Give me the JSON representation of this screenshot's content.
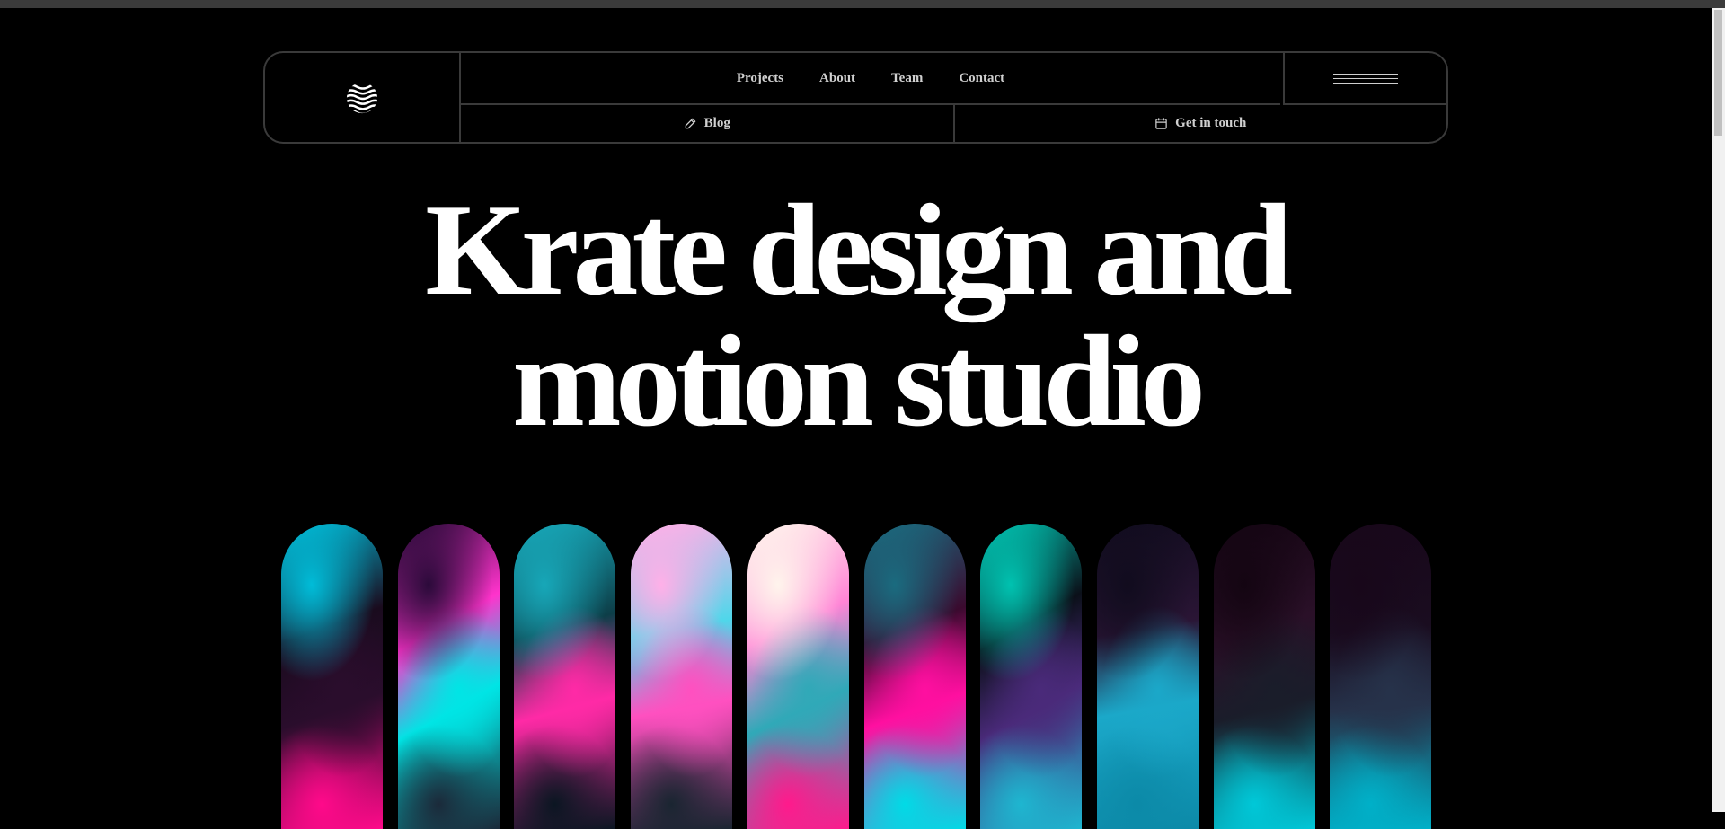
{
  "nav": {
    "logo_name": "wave-logo",
    "links": [
      "Projects",
      "About",
      "Team",
      "Contact"
    ],
    "blog_label": "Blog",
    "contact_label": "Get in touch"
  },
  "hero": {
    "line1": "Krate design and",
    "line2": "motion studio"
  },
  "gallery": {
    "pills": [
      {
        "name": "gradient-pill-1",
        "colors": [
          "#00bcd8",
          "#1a0b1e",
          "#2a0d2c",
          "#ff0a8a"
        ]
      },
      {
        "name": "gradient-pill-2",
        "colors": [
          "#2b0a3a",
          "#ff33cc",
          "#00e5e5",
          "#1b2a3a"
        ]
      },
      {
        "name": "gradient-pill-3",
        "colors": [
          "#17a7b8",
          "#0d3e48",
          "#ff2aa6",
          "#0b1622"
        ]
      },
      {
        "name": "gradient-pill-4",
        "colors": [
          "#ffb0e8",
          "#4fd7ea",
          "#ff50c0",
          "#1a2531"
        ]
      },
      {
        "name": "gradient-pill-5",
        "colors": [
          "#fff4ec",
          "#ff84d6",
          "#30a9b8",
          "#ff1a8c"
        ]
      },
      {
        "name": "gradient-pill-6",
        "colors": [
          "#1a6b7f",
          "#3a0a2e",
          "#ff0fa0",
          "#00dbe6"
        ]
      },
      {
        "name": "gradient-pill-7",
        "colors": [
          "#00c2b0",
          "#0b1019",
          "#4a2a7a",
          "#1eb6d0"
        ]
      },
      {
        "name": "gradient-pill-8",
        "colors": [
          "#110c1e",
          "#2a1535",
          "#1ba8c9",
          "#0c8aa8"
        ]
      },
      {
        "name": "gradient-pill-9",
        "colors": [
          "#140512",
          "#2a1028",
          "#1a1d2a",
          "#00c8d8"
        ]
      },
      {
        "name": "gradient-pill-10",
        "colors": [
          "#18071a",
          "#1a0d20",
          "#26324a",
          "#00b0c8"
        ]
      }
    ]
  }
}
